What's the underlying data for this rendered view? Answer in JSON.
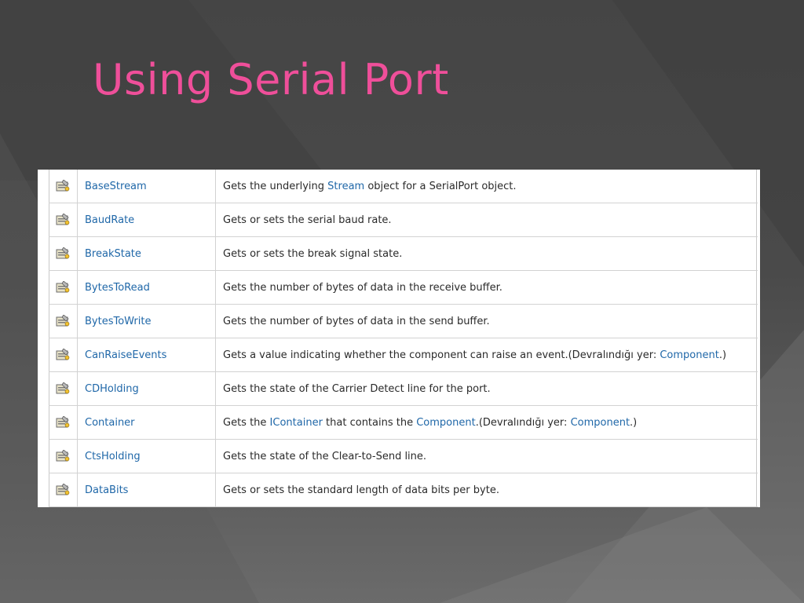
{
  "slide": {
    "title": "Using Serial Port"
  },
  "icon_name": "property-icon",
  "colors": {
    "title": "#ef4f9a",
    "link": "#1f67a8",
    "text": "#2a2a2a"
  },
  "properties": [
    {
      "name": "BaseStream",
      "desc": [
        {
          "t": "Gets the underlying "
        },
        {
          "t": "Stream",
          "link": true
        },
        {
          "t": " object for a SerialPort object."
        }
      ]
    },
    {
      "name": "BaudRate",
      "desc": [
        {
          "t": "Gets or sets the serial baud rate."
        }
      ]
    },
    {
      "name": "BreakState",
      "desc": [
        {
          "t": "Gets or sets the break signal state."
        }
      ]
    },
    {
      "name": "BytesToRead",
      "desc": [
        {
          "t": "Gets the number of bytes of data in the receive buffer."
        }
      ]
    },
    {
      "name": "BytesToWrite",
      "desc": [
        {
          "t": "Gets the number of bytes of data in the send buffer."
        }
      ]
    },
    {
      "name": "CanRaiseEvents",
      "desc": [
        {
          "t": "Gets a value indicating whether the component can raise an event.(Devralındığı yer: "
        },
        {
          "t": "Component",
          "link": true
        },
        {
          "t": ".)"
        }
      ]
    },
    {
      "name": "CDHolding",
      "desc": [
        {
          "t": "Gets the state of the Carrier Detect line for the port."
        }
      ]
    },
    {
      "name": "Container",
      "desc": [
        {
          "t": "Gets the "
        },
        {
          "t": "IContainer",
          "link": true
        },
        {
          "t": " that contains the "
        },
        {
          "t": "Component",
          "link": true
        },
        {
          "t": ".(Devralındığı yer: "
        },
        {
          "t": "Component",
          "link": true
        },
        {
          "t": ".)"
        }
      ]
    },
    {
      "name": "CtsHolding",
      "desc": [
        {
          "t": "Gets the state of the Clear-to-Send line."
        }
      ]
    },
    {
      "name": "DataBits",
      "desc": [
        {
          "t": "Gets or sets the standard length of data bits per byte."
        }
      ]
    }
  ]
}
